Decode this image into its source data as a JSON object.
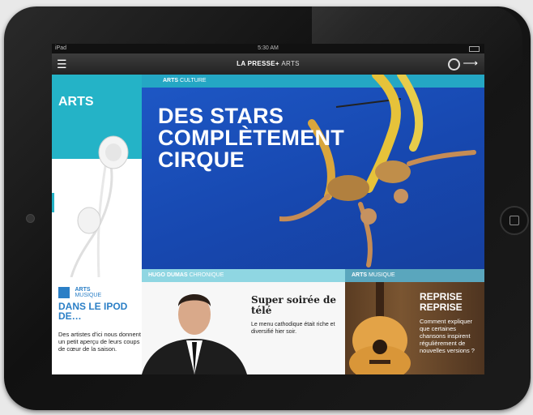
{
  "status_bar": {
    "carrier": "iPad",
    "time": "5:30 AM"
  },
  "nav": {
    "brand": "LA PRESSE+",
    "section": "ARTS"
  },
  "left_column": {
    "title": "ARTS",
    "tag_main": "ARTS",
    "tag_sub": "MUSIQUE",
    "headline": "DANS LE IPOD DE…",
    "description": "Des artistes d'ici nous donnent un petit aperçu de leurs coups de cœur de la saison."
  },
  "hero": {
    "kicker_main": "ARTS",
    "kicker_sub": "CULTURE",
    "title_line1": "DES STARS",
    "title_line2": "COMPLÈTEMENT",
    "title_line3": "CIRQUE"
  },
  "chronique": {
    "kicker_main": "HUGO DUMAS",
    "kicker_sub": "CHRONIQUE",
    "title": "Super soirée de télé",
    "description": "Le menu cathodique était riche et diversifié hier soir."
  },
  "music": {
    "kicker_main": "ARTS",
    "kicker_sub": "MUSIQUE",
    "title_line1": "REPRISE",
    "title_line2": "REPRISE",
    "description": "Comment expliquer que certaines chansons inspirent régulièrement de nouvelles versions ?"
  },
  "colors": {
    "accent": "#24b3c7",
    "hero_blue": "#1a4fb5",
    "link_blue": "#2b7fc6"
  }
}
